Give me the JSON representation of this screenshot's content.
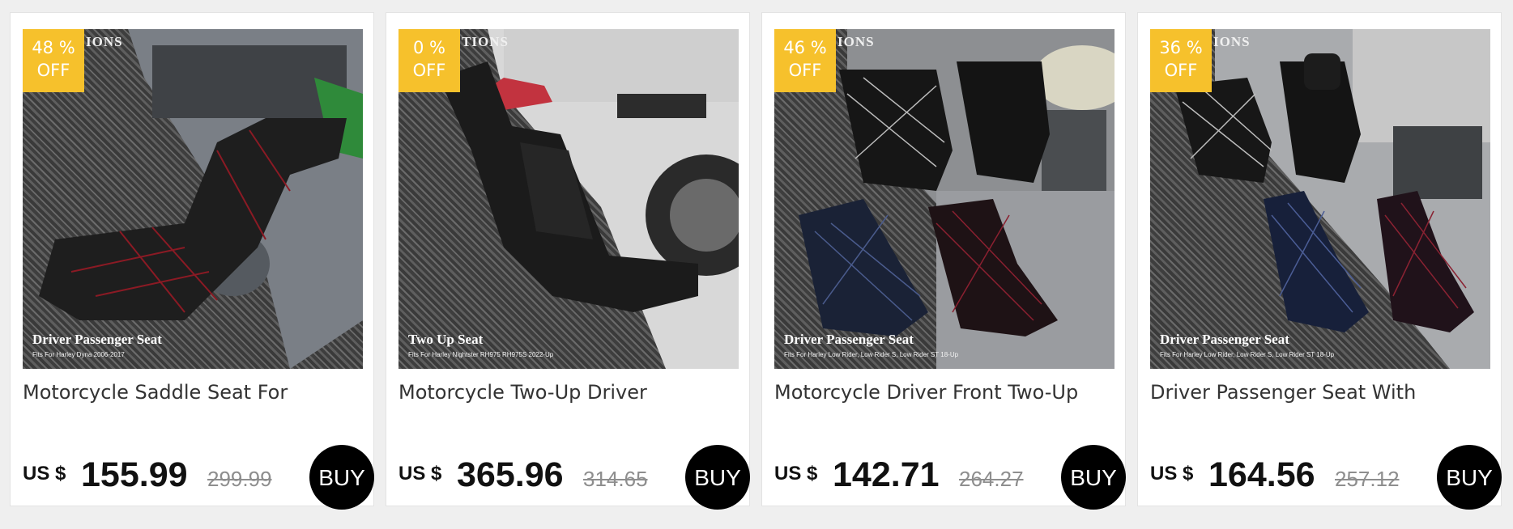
{
  "products": [
    {
      "discount": "48 %",
      "off_label": "OFF",
      "brand_text": "IONS",
      "image_caption": "Driver Passenger Seat",
      "image_subcaption": "Fits For Harley Dyna 2006-2017",
      "title": "Motorcycle Saddle Seat For",
      "currency": "US $",
      "price": "155.99",
      "old_price": "299.99",
      "buy_label": "BUY"
    },
    {
      "discount": "0 %",
      "off_label": "OFF",
      "brand_text": "TIONS",
      "image_caption": "Two Up Seat",
      "image_subcaption": "Fits For Harley Nightster RH975 RH975S 2022-Up",
      "title": "Motorcycle Two-Up Driver",
      "currency": "US $",
      "price": "365.96",
      "old_price": "314.65",
      "buy_label": "BUY"
    },
    {
      "discount": "46 %",
      "off_label": "OFF",
      "brand_text": "IONS",
      "image_caption": "Driver Passenger Seat",
      "image_subcaption": "Fits For Harley Low Rider,   Low Rider S,   Low Rider ST 18-Up",
      "title": "Motorcycle Driver Front Two-Up",
      "currency": "US $",
      "price": "142.71",
      "old_price": "264.27",
      "buy_label": "BUY"
    },
    {
      "discount": "36 %",
      "off_label": "OFF",
      "brand_text": "IONS",
      "image_caption": "Driver Passenger Seat",
      "image_subcaption": "Fits For Harley Low Rider,   Low Rider S,   Low Rider ST 18-Up",
      "title": "Driver Passenger Seat With",
      "currency": "US $",
      "price": "164.56",
      "old_price": "257.12",
      "buy_label": "BUY"
    }
  ],
  "colors": {
    "badge": "#f6c12c",
    "buy_button": "#000000",
    "old_price": "#8e8e8e"
  }
}
